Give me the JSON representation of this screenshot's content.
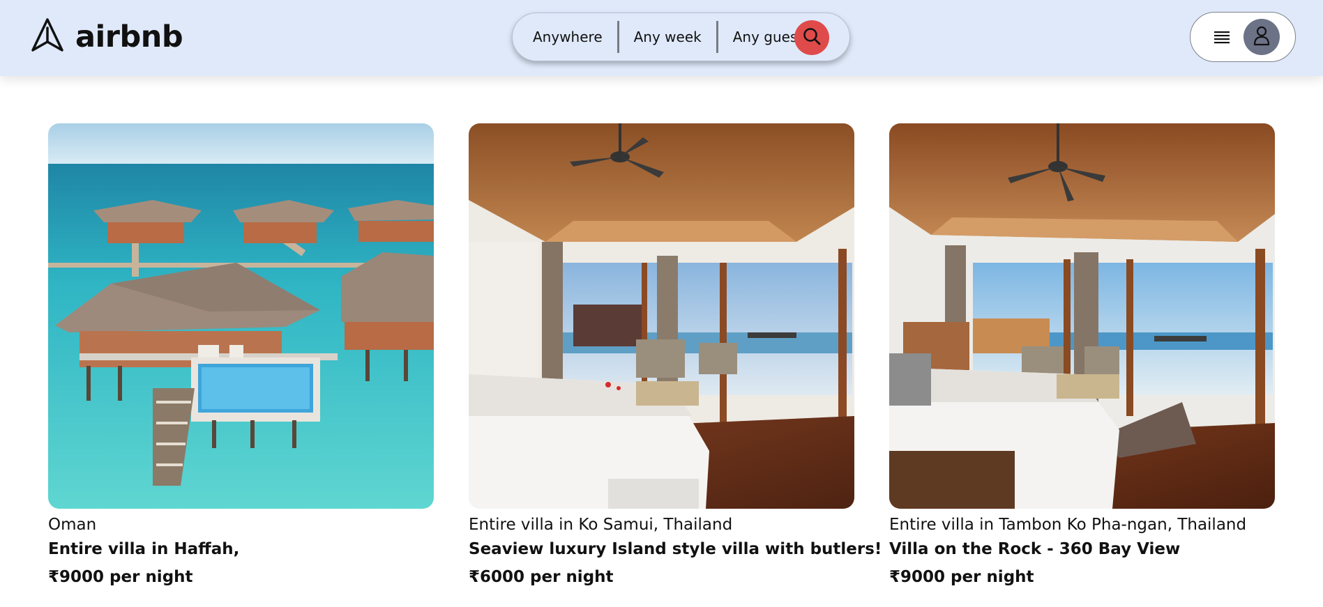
{
  "header": {
    "brand_name": "airbnb",
    "logo_icon": "airbnb-logo-icon",
    "search": {
      "location": "Anywhere",
      "week": "Any week",
      "guests": "Any guest",
      "search_icon": "search-icon",
      "button_color": "#df4b4b"
    },
    "user_menu": {
      "menu_icon": "hamburger-menu-icon",
      "avatar_icon": "user-avatar-icon"
    },
    "background_color": "#dfe9fa"
  },
  "listings": [
    {
      "image": "overwater-villas-photo",
      "location": "Oman",
      "title": "Entire villa in Haffah,",
      "price": "₹9000 per night"
    },
    {
      "image": "bedroom-sea-view-photo",
      "location": "Entire villa in Ko Samui, Thailand",
      "title": "Seaview luxury Island style villa with butlers!",
      "price": "₹6000 per night"
    },
    {
      "image": "bedroom-bay-view-photo",
      "location": "Entire villa in Tambon Ko Pha-ngan, Thailand",
      "title": "Villa on the Rock - 360 Bay View",
      "price": "₹9000 per night"
    }
  ]
}
